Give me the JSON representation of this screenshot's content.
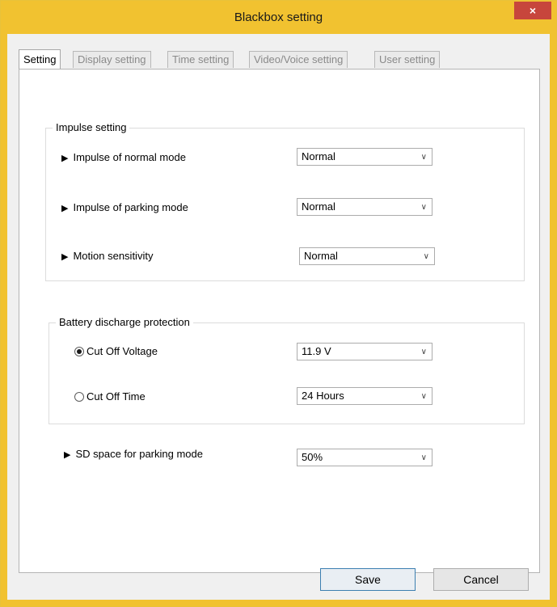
{
  "window": {
    "title": "Blackbox setting",
    "close_label": "×"
  },
  "tabs": [
    {
      "label": "Setting",
      "active": true
    },
    {
      "label": "Display setting",
      "active": false
    },
    {
      "label": "Time setting",
      "active": false
    },
    {
      "label": "Video/Voice setting",
      "active": false
    },
    {
      "label": "User setting",
      "active": false
    }
  ],
  "impulse": {
    "title": "Impulse setting",
    "rows": [
      {
        "label": "Impulse of normal mode",
        "value": "Normal"
      },
      {
        "label": "Impulse of parking mode",
        "value": "Normal"
      },
      {
        "label": "Motion sensitivity",
        "value": "Normal"
      }
    ]
  },
  "battery": {
    "title": "Battery discharge protection",
    "options": [
      {
        "label": "Cut Off Voltage",
        "selected": true,
        "value": "11.9 V"
      },
      {
        "label": "Cut Off Time",
        "selected": false,
        "value": "24 Hours"
      }
    ]
  },
  "sd": {
    "label": "SD space for parking mode",
    "value": "50%"
  },
  "buttons": {
    "save": "Save",
    "cancel": "Cancel"
  },
  "icons": {
    "row_marker": "play-triangle-icon",
    "dropdown": "chevron-down-icon"
  },
  "colors": {
    "titlebar": "#f1c230",
    "close": "#c7463c"
  }
}
